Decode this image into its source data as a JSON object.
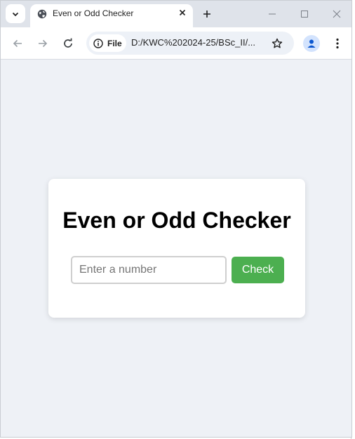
{
  "browser": {
    "tab": {
      "title": "Even or Odd Checker",
      "favicon": "globe-icon"
    },
    "toolbar": {
      "site_chip_label": "File",
      "url": "D:/KWC%202024-25/BSc_II/..."
    }
  },
  "page": {
    "title": "Even or Odd Checker",
    "input_placeholder": "Enter a number",
    "input_value": "",
    "check_button_label": "Check"
  },
  "colors": {
    "button": "#4caf50",
    "page_background": "#eef1f6",
    "card": "#ffffff"
  }
}
